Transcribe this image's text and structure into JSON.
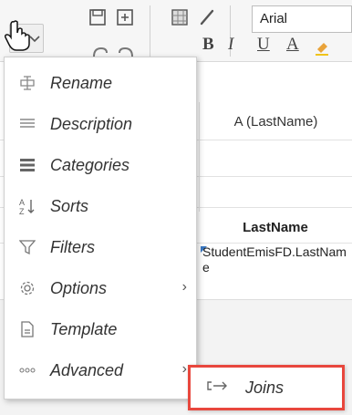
{
  "toolbar": {
    "save_icon": "save-icon",
    "add_icon": "add-box-icon",
    "fill_icon": "pattern-fill-icon",
    "brush_icon": "brush-icon",
    "font_name": "Arial",
    "bold": "B",
    "italic": "I",
    "underline": "U",
    "font_color": "A"
  },
  "grid": {
    "column_a_header": "A (LastName)",
    "column_title": "LastName",
    "field_value": "StudentEmisFD.LastName"
  },
  "menu": {
    "items": [
      {
        "icon": "rename-icon",
        "label": "Rename"
      },
      {
        "icon": "description-icon",
        "label": "Description"
      },
      {
        "icon": "categories-icon",
        "label": "Categories"
      },
      {
        "icon": "sort-icon",
        "label": "Sorts"
      },
      {
        "icon": "filter-icon",
        "label": "Filters"
      },
      {
        "icon": "gear-icon",
        "label": "Options",
        "arrow": "›"
      },
      {
        "icon": "template-icon",
        "label": "Template"
      },
      {
        "icon": "more-icon",
        "label": "Advanced",
        "arrow": "›"
      }
    ]
  },
  "submenu": {
    "icon": "join-icon",
    "label": "Joins",
    "highlight_color": "#e8473d"
  }
}
